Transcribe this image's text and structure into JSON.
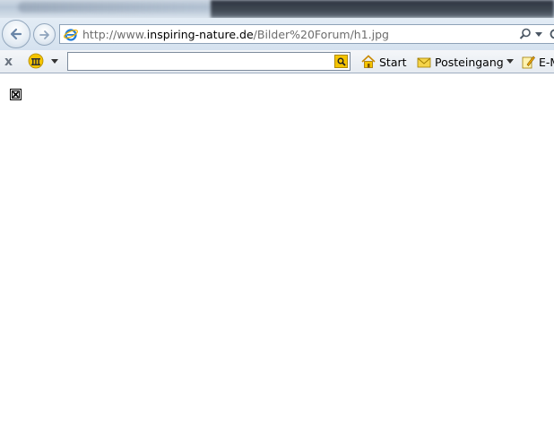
{
  "address_bar": {
    "url_prefix": "http://www.",
    "url_domain": "inspiring-nature.de",
    "url_path": "/Bilder%20Forum/h1.jpg"
  },
  "toolbar": {
    "close_label": "x",
    "search_value": "",
    "start_label": "Start",
    "inbox_label": "Posteingang",
    "email_label": "E-M"
  },
  "icons": {
    "back": "back-arrow-icon",
    "forward": "forward-arrow-icon",
    "page": "internet-explorer-icon",
    "search": "magnifier-icon",
    "refresh": "refresh-icon",
    "home": "house-icon",
    "mail": "envelope-icon",
    "compose": "pencil-note-icon",
    "broken_image": "broken-image-icon"
  },
  "colors": {
    "search_button": "#f5c400",
    "ie_blue": "#1f7ad6"
  }
}
